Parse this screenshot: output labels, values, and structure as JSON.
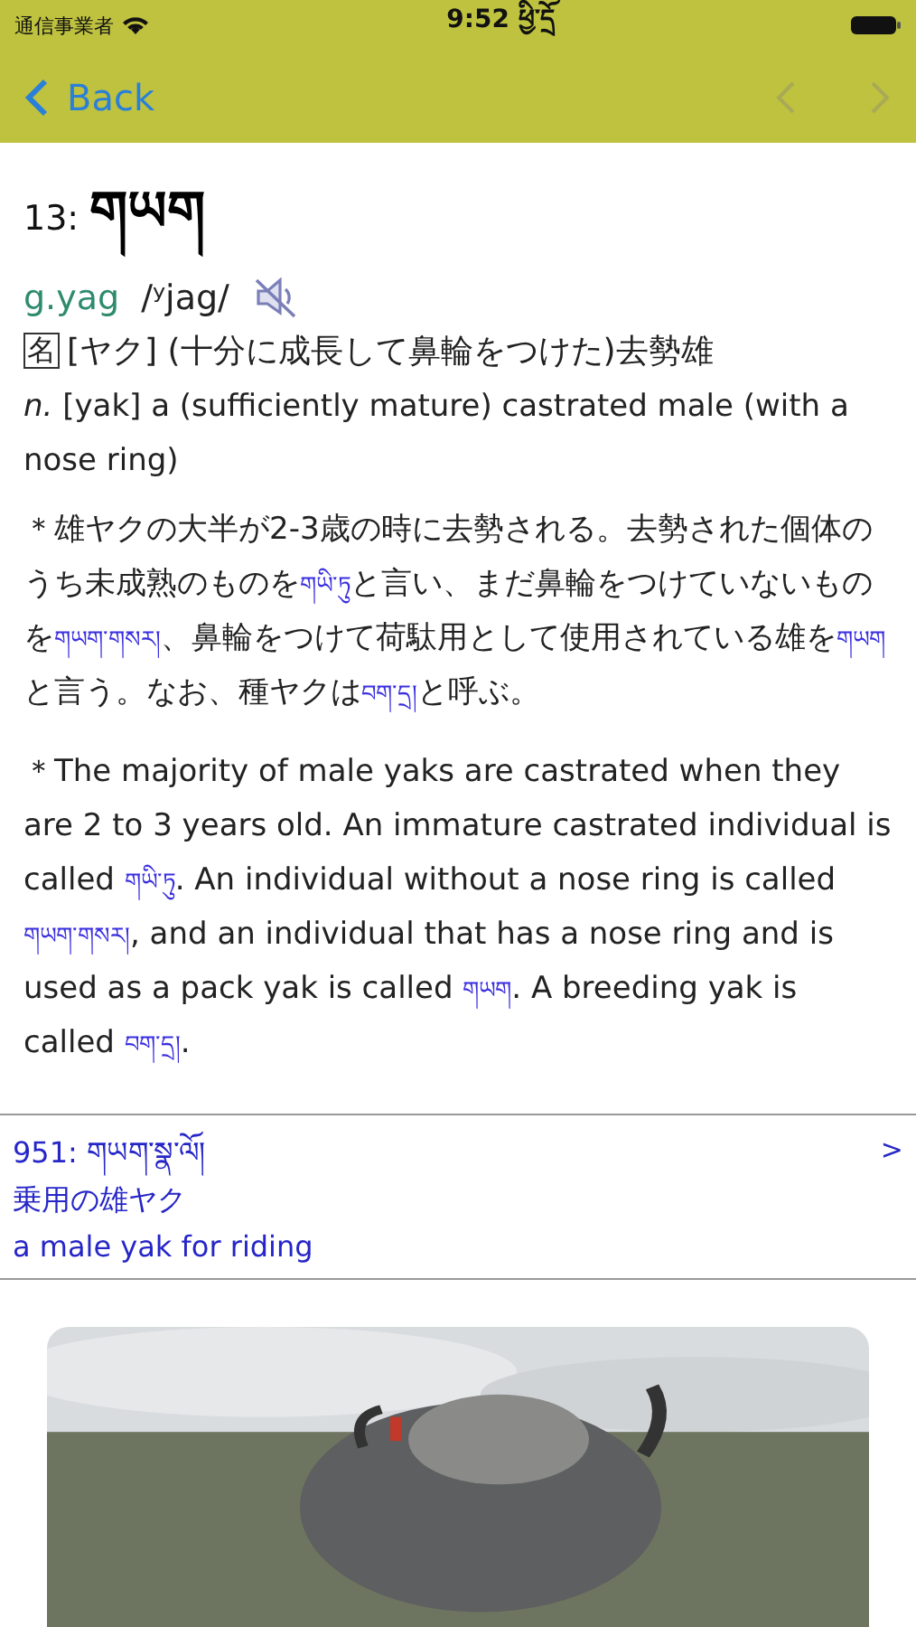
{
  "status_bar": {
    "carrier": "通信事業者",
    "time": "9:52 ཕྱི་དྲོ"
  },
  "nav": {
    "back": "Back",
    "prev_disabled": true,
    "next_disabled": true
  },
  "entry": {
    "number": "13:",
    "headword": "གཡག",
    "romanization": "g.yag",
    "pronunciation": "/ʸjag/",
    "pos": "名",
    "definition_ja": "[ヤク] (十分に成長して鼻輪をつけた)去勢雄",
    "definition_en": "*n.* [yak] a (sufficiently mature) castrated male (with a nose ring)",
    "notes": [
      [
        {
          "kind": "plain",
          "text": "＊雄ヤクの大半が2-3歳の時に去勢される。去勢された個体のうち未成熟のものを"
        },
        {
          "kind": "tibetan",
          "text": "གཡི་ཏུ"
        },
        {
          "kind": "plain",
          "text": "と言い、まだ鼻輪をつけていないものを"
        },
        {
          "kind": "tibetan",
          "text": "གཡག་གསར།"
        },
        {
          "kind": "plain",
          "text": "、鼻輪をつけて荷駄用として使用されている雄を"
        },
        {
          "kind": "tibetan",
          "text": "གཡག"
        },
        {
          "kind": "plain",
          "text": "と言う。なお、種ヤクは"
        },
        {
          "kind": "tibetan",
          "text": "བག་དྲ།"
        },
        {
          "kind": "plain",
          "text": "と呼ぶ。"
        }
      ],
      [
        {
          "kind": "plain",
          "text": "＊The majority of male yaks are castrated when they are 2 to 3 years old. An immature castrated individual is called "
        },
        {
          "kind": "tibetan",
          "text": "གཡི་ཏུ"
        },
        {
          "kind": "plain",
          "text": ". An individual without a nose ring is called "
        },
        {
          "kind": "tibetan",
          "text": "གཡག་གསར།"
        },
        {
          "kind": "plain",
          "text": ", and an individual that has a nose ring and is used as a pack yak is called "
        },
        {
          "kind": "tibetan",
          "text": "གཡག"
        },
        {
          "kind": "plain",
          "text": ". A breeding yak is called "
        },
        {
          "kind": "tibetan",
          "text": "བག་དྲ།"
        },
        {
          "kind": "plain",
          "text": "."
        }
      ]
    ]
  },
  "related": [
    {
      "number": "951:",
      "headword": "གཡག་སྣ་ལོ།",
      "ja": "乗用の雄ヤク",
      "en": "a male yak for riding",
      "chevron": ">"
    }
  ]
}
